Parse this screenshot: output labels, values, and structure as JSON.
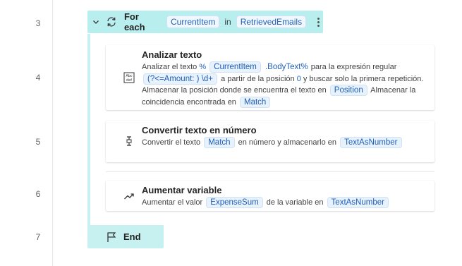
{
  "line_numbers": [
    "3",
    "4",
    "5",
    "6",
    "7"
  ],
  "loop": {
    "keyword": "For each",
    "item_var": "CurrentItem",
    "in_label": "in",
    "collection_var": "RetrievedEmails"
  },
  "actions": [
    {
      "title": "Analizar texto",
      "desc": {
        "t1": "Analizar el texto",
        "pct1": "%",
        "var1": "CurrentItem",
        "expr": ".BodyText%",
        "t2": "para la expresión regular",
        "regex": "(?<=Amount: ) \\d+",
        "t3": "a partir de la posición",
        "pos": "0",
        "t4": "y buscar solo la primera repetición. Almacenar la posición donde se encuentra el texto en",
        "var2": "Position",
        "t5": "Almacenar la coincidencia encontrada en",
        "var3": "Match"
      }
    },
    {
      "title": "Convertir texto en número",
      "desc": {
        "t1": "Convertir el texto",
        "var1": "Match",
        "t2": "en número y almacenarlo en",
        "var2": "TextAsNumber"
      }
    },
    {
      "title": "Aumentar variable",
      "desc": {
        "t1": "Aumentar el valor",
        "var1": "ExpenseSum",
        "t2": "de la variable en",
        "var2": "TextAsNumber"
      }
    }
  ],
  "end": {
    "label": "End"
  },
  "icons": {
    "collapse": "chevron-down-icon",
    "loop": "loop-icon",
    "more": "more-vertical-icon",
    "parse_text": "parse-text-icon",
    "convert": "convert-number-icon",
    "increase": "trending-up-icon",
    "end": "flag-icon"
  },
  "colors": {
    "loop_bg": "#b9eeee",
    "end_bg": "#c7f0f0",
    "var_pill_text": "#1f5fb8",
    "var_pill_bg": "#e8f2fc"
  }
}
